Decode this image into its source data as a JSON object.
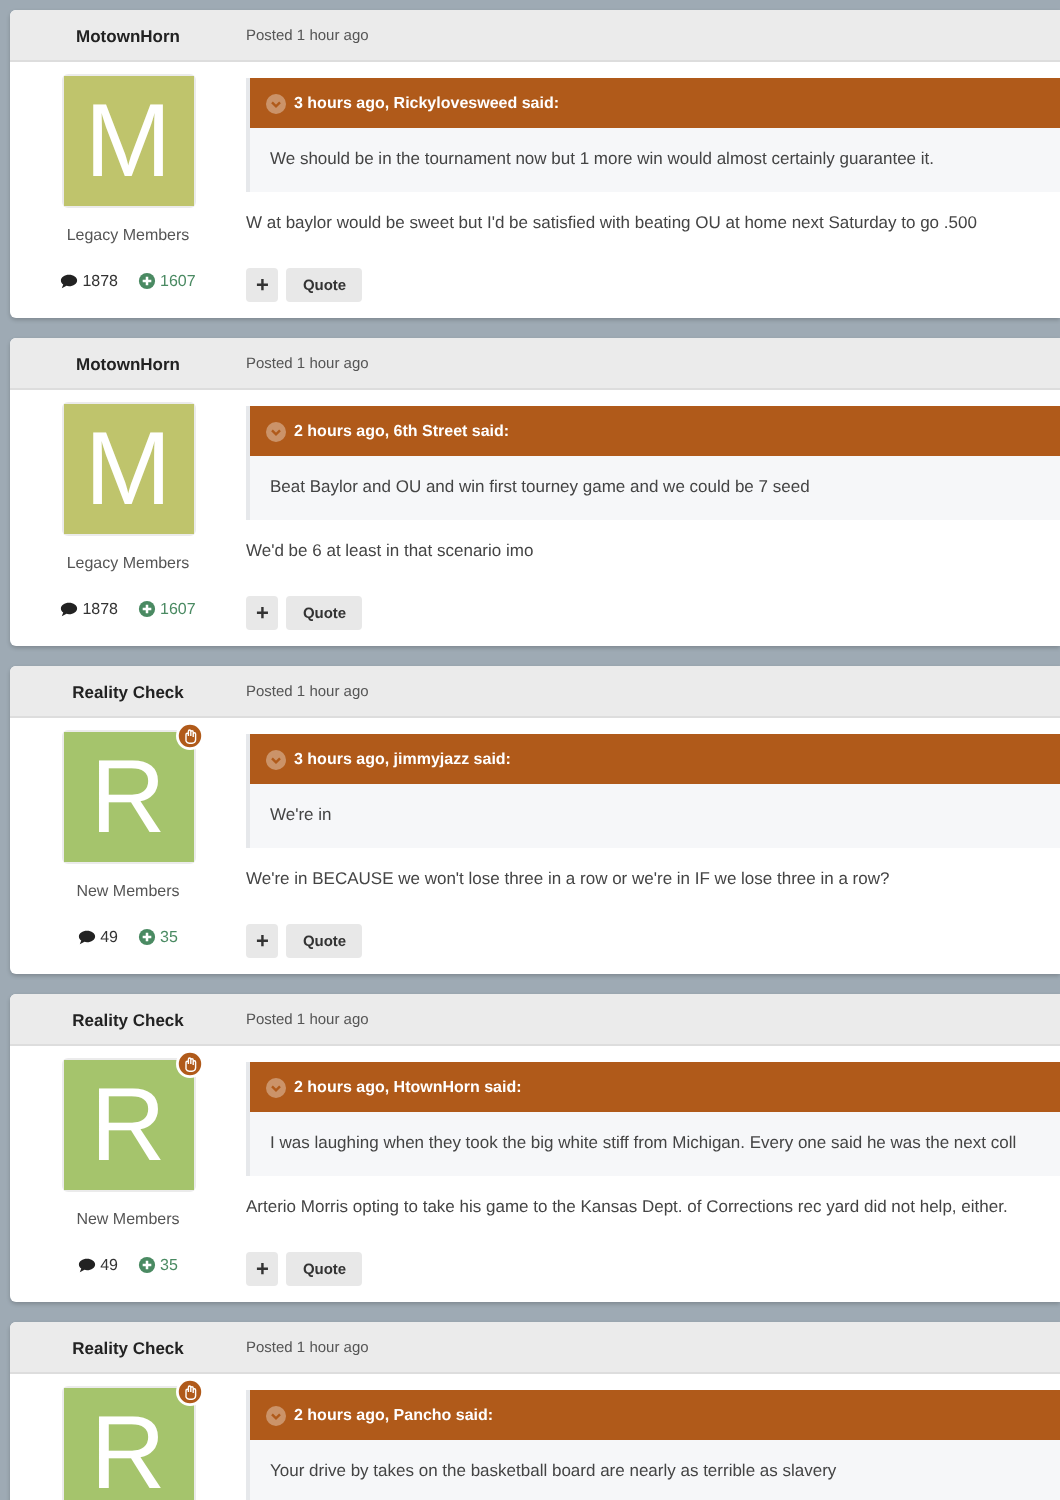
{
  "posts": [
    {
      "author": "MotownHorn",
      "posted": "Posted 1 hour ago",
      "avatar": {
        "letter": "M",
        "color": "#bfc46c",
        "badge": false
      },
      "group": "Legacy Members",
      "posts_count": "1878",
      "reputation": "1607",
      "quote": {
        "header": "3 hours ago, Rickylovesweed said:",
        "text": "We should be in the tournament now but 1 more win would almost certainly guarantee it."
      },
      "text": "W at baylor would be sweet but I'd be satisfied with beating OU at home next Saturday to go .500",
      "buttons": [
        "+",
        "Quote"
      ]
    },
    {
      "author": "MotownHorn",
      "posted": "Posted 1 hour ago",
      "avatar": {
        "letter": "M",
        "color": "#bfc46c",
        "badge": false
      },
      "group": "Legacy Members",
      "posts_count": "1878",
      "reputation": "1607",
      "quote": {
        "header": "2 hours ago, 6th Street said:",
        "text": "Beat Baylor and OU and win first tourney game and we could be 7 seed"
      },
      "text": "We'd be 6 at least in that scenario imo",
      "buttons": [
        "+",
        "Quote"
      ]
    },
    {
      "author": "Reality Check",
      "posted": "Posted 1 hour ago",
      "avatar": {
        "letter": "R",
        "color": "#a5c46c",
        "badge": true
      },
      "group": "New Members",
      "posts_count": "49",
      "reputation": "35",
      "quote": {
        "header": "3 hours ago, jimmyjazz said:",
        "text": "We're in"
      },
      "text": "We're in BECAUSE we won't lose three in a row or we're in IF we lose three in a row?",
      "buttons": [
        "+",
        "Quote"
      ]
    },
    {
      "author": "Reality Check",
      "posted": "Posted 1 hour ago",
      "avatar": {
        "letter": "R",
        "color": "#a5c46c",
        "badge": true
      },
      "group": "New Members",
      "posts_count": "49",
      "reputation": "35",
      "quote": {
        "header": "2 hours ago, HtownHorn said:",
        "text": "I was laughing when they took the big white stiff from Michigan. Every one said he was the next coll"
      },
      "text": "Arterio Morris opting to take his game to the Kansas Dept. of Corrections rec yard did not help, either.",
      "buttons": [
        "+",
        "Quote"
      ]
    },
    {
      "author": "Reality Check",
      "posted": "Posted 1 hour ago",
      "avatar": {
        "letter": "R",
        "color": "#a5c46c",
        "badge": true
      },
      "quote": {
        "header": "2 hours ago, Pancho said:",
        "text": "Your drive by takes on the basketball board are nearly as terrible as slavery"
      }
    }
  ]
}
